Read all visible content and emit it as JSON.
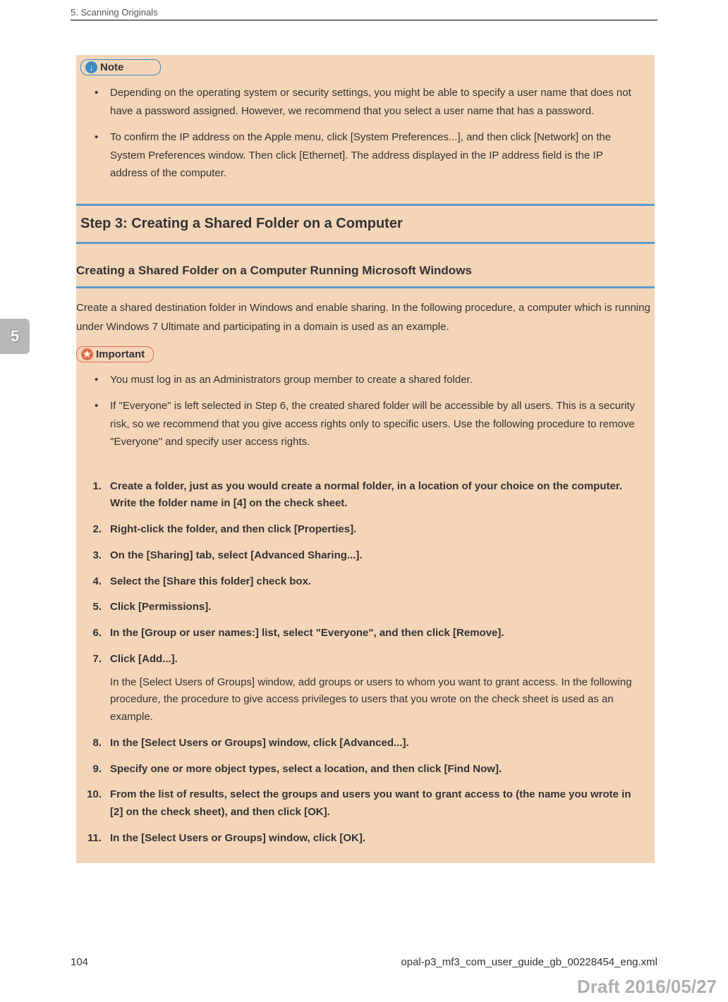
{
  "header": {
    "chapter": "5. Scanning Originals"
  },
  "tab": {
    "chapter_num": "5"
  },
  "note": {
    "label": "Note",
    "items": [
      "Depending on the operating system or security settings, you might be able to specify a user name that does not have a password assigned. However, we recommend that you select a user name that has a password.",
      "To confirm the IP address on the Apple menu, click [System Preferences...], and then click [Network] on the System Preferences window. Then click [Ethernet]. The address displayed in the IP address field is the IP address of the computer."
    ]
  },
  "step3": {
    "heading": "Step 3: Creating a Shared Folder on a Computer",
    "subheading": "Creating a Shared Folder on a Computer Running Microsoft Windows",
    "intro": "Create a shared destination folder in Windows and enable sharing. In the following procedure, a computer which is running under Windows 7 Ultimate and participating in a domain is used as an example."
  },
  "important": {
    "label": "Important",
    "items": [
      "You must log in as an Administrators group member to create a shared folder.",
      "If \"Everyone\" is left selected in Step 6, the created shared folder will be accessible by all users. This is a security risk, so we recommend that you give access rights only to specific users. Use the following procedure to remove \"Everyone\" and specify user access rights."
    ]
  },
  "steps": [
    {
      "title": "Create a folder, just as you would create a normal folder, in a location of your choice on the computer. Write the folder name in [4] on the check sheet."
    },
    {
      "title": "Right-click the folder, and then click [Properties]."
    },
    {
      "title": "On the [Sharing] tab, select [Advanced Sharing...]."
    },
    {
      "title": "Select the [Share this folder] check box."
    },
    {
      "title": "Click [Permissions]."
    },
    {
      "title": "In the [Group or user names:] list, select \"Everyone\", and then click [Remove]."
    },
    {
      "title": "Click [Add...].",
      "note": "In the [Select Users of Groups] window, add groups or users to whom you want to grant access. In the following procedure, the procedure to give access privileges to users that you wrote on the check sheet is used as an example."
    },
    {
      "title": "In the [Select Users or Groups] window, click [Advanced...]."
    },
    {
      "title": "Specify one or more object types, select a location, and then click [Find Now]."
    },
    {
      "title": "From the list of results, select the groups and users you want to grant access to (the name you wrote in [2] on the check sheet), and then click [OK]."
    },
    {
      "title": "In the [Select Users or Groups] window, click [OK]."
    }
  ],
  "footer": {
    "page": "104",
    "filename": "opal-p3_mf3_com_user_guide_gb_00228454_eng.xml",
    "draft": "Draft 2016/05/27"
  }
}
